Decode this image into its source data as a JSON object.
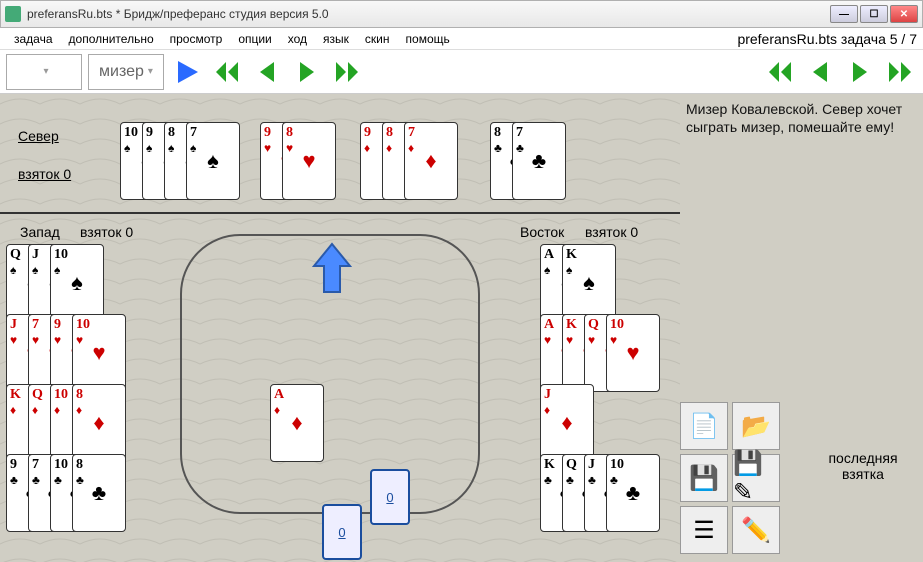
{
  "title": "preferansRu.bts * Бридж/преферанс студия версия 5.0",
  "menu": {
    "task": "задача",
    "extra": "дополнительно",
    "view": "просмотр",
    "options": "опции",
    "move": "ход",
    "lang": "язык",
    "skin": "скин",
    "help": "помощь",
    "right": "preferansRu.bts задача 5 / 7"
  },
  "toolbar": {
    "dropdown2": "мизер"
  },
  "colors": {
    "play": "#2a6aff",
    "nav": "#24a424"
  },
  "labels": {
    "north": "Север",
    "north_tricks": "взяток 0",
    "west": "Запад",
    "west_tricks": "взяток 0",
    "east": "Восток",
    "east_tricks": "взяток 0"
  },
  "comment": "Мизер Ковалевской. Север хочет сыграть мизер, помешайте ему!",
  "last_trick": "последняя взятка",
  "deck": {
    "a": "0",
    "b": "0"
  },
  "center_card": {
    "rank": "A",
    "suit": "♦",
    "color": "red"
  },
  "north_hand": [
    {
      "rank": "10",
      "suit": "♠"
    },
    {
      "rank": "9",
      "suit": "♠"
    },
    {
      "rank": "8",
      "suit": "♠"
    },
    {
      "rank": "7",
      "suit": "♠"
    },
    {
      "rank": "9",
      "suit": "♥"
    },
    {
      "rank": "8",
      "suit": "♥"
    },
    {
      "rank": "9",
      "suit": "♦"
    },
    {
      "rank": "8",
      "suit": "♦"
    },
    {
      "rank": "7",
      "suit": "♦"
    },
    {
      "rank": "8",
      "suit": "♣"
    },
    {
      "rank": "7",
      "suit": "♣"
    }
  ],
  "west_hand": [
    {
      "rank": "Q",
      "suit": "♠"
    },
    {
      "rank": "J",
      "suit": "♠"
    },
    {
      "rank": "10",
      "suit": "♠"
    },
    {
      "rank": "J",
      "suit": "♥"
    },
    {
      "rank": "7",
      "suit": "♥"
    },
    {
      "rank": "9",
      "suit": "♥"
    },
    {
      "rank": "10",
      "suit": "♥"
    },
    {
      "rank": "K",
      "suit": "♦"
    },
    {
      "rank": "Q",
      "suit": "♦"
    },
    {
      "rank": "10",
      "suit": "♦"
    },
    {
      "rank": "8",
      "suit": "♦"
    },
    {
      "rank": "9",
      "suit": "♣"
    },
    {
      "rank": "7",
      "suit": "♣"
    },
    {
      "rank": "10",
      "suit": "♣"
    },
    {
      "rank": "8",
      "suit": "♣"
    }
  ],
  "east_hand": [
    {
      "rank": "A",
      "suit": "♠"
    },
    {
      "rank": "K",
      "suit": "♠"
    },
    {
      "rank": "A",
      "suit": "♥"
    },
    {
      "rank": "K",
      "suit": "♥"
    },
    {
      "rank": "Q",
      "suit": "♥"
    },
    {
      "rank": "10",
      "suit": "♥"
    },
    {
      "rank": "J",
      "suit": "♦"
    },
    {
      "rank": "K",
      "suit": "♣"
    },
    {
      "rank": "Q",
      "suit": "♣"
    },
    {
      "rank": "J",
      "suit": "♣"
    },
    {
      "rank": "10",
      "suit": "♣"
    }
  ]
}
